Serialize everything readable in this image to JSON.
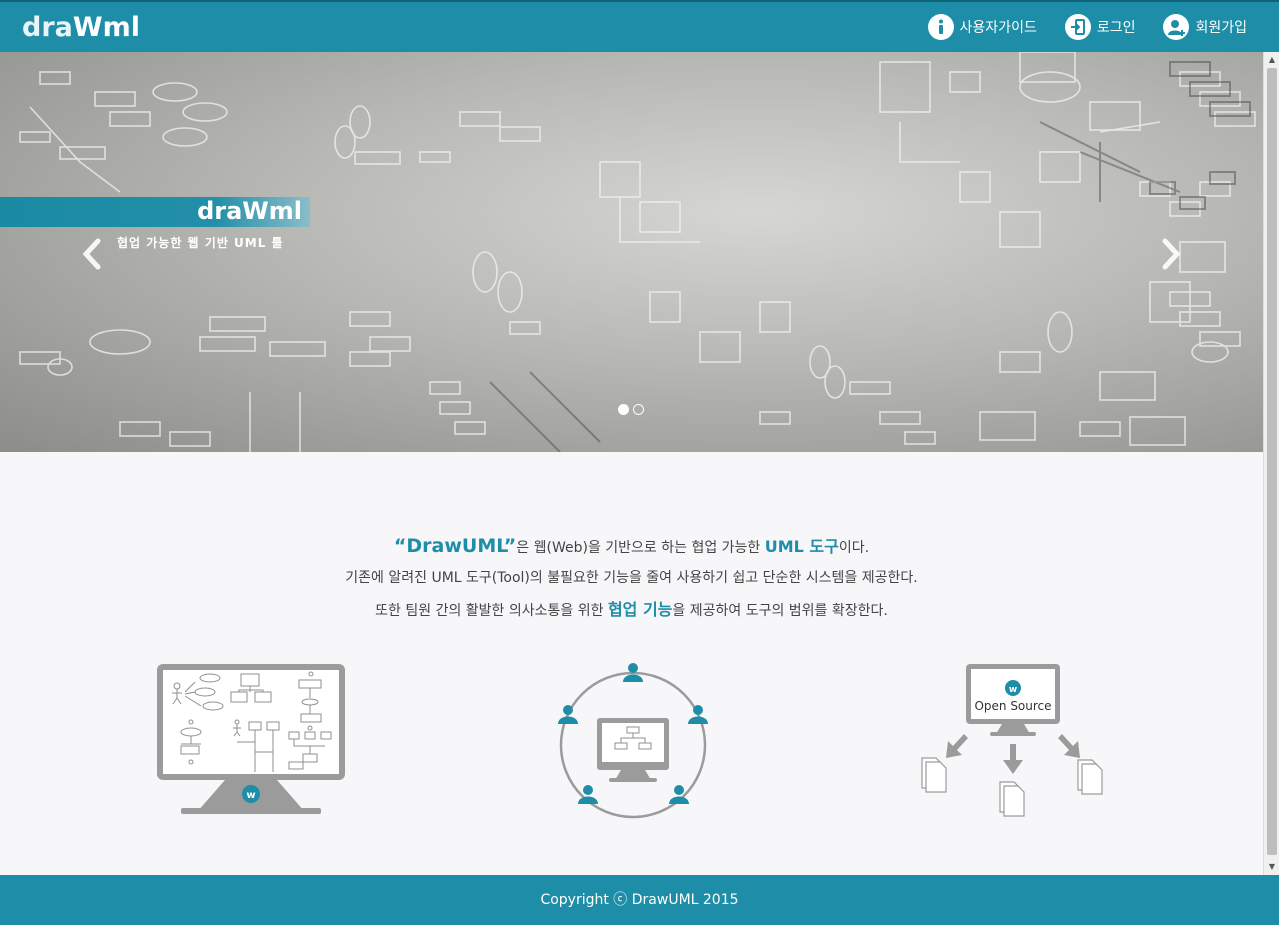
{
  "header": {
    "logo_light": "dra",
    "logo_bold": "Wml",
    "nav": [
      {
        "label": "사용자가이드",
        "icon": "info-icon"
      },
      {
        "label": "로그인",
        "icon": "login-icon"
      },
      {
        "label": "회원가입",
        "icon": "user-add-icon"
      }
    ]
  },
  "carousel": {
    "banner_logo": "draWml",
    "caption": "협업 가능한 웹 기반 UML 툴",
    "prev_icon": "chevron-left-icon",
    "next_icon": "chevron-right-icon",
    "slides_count": 2,
    "active_slide": 1
  },
  "intro": {
    "line1_brand": "“DrawUML”",
    "line1_a": "은 웹(Web)을 기반으로 하는 협업 가능한 ",
    "line1_accent": "UML 도구",
    "line1_b": "이다.",
    "line2": "기존에 알려진 UML 도구(Tool)의 불필요한 기능을 줄여 사용하기 쉽고 단순한 시스템을 제공한다.",
    "line3_a": "또한 팀원 간의 활발한 의사소통을 위한 ",
    "line3_accent": "협업 기능",
    "line3_b": "을 제공하여 도구의 범위를 확장한다."
  },
  "features": [
    {
      "icon": "uml-monitor-icon",
      "badge": "w"
    },
    {
      "icon": "collaboration-icon"
    },
    {
      "icon": "open-source-icon",
      "badge": "w",
      "label": "Open Source"
    }
  ],
  "footer": {
    "text": "Copyright ⓒ DrawUML 2015"
  },
  "colors": {
    "primary": "#1e8ea8",
    "background": "#f7f7f9",
    "icon_gray": "#9b9b9b"
  }
}
